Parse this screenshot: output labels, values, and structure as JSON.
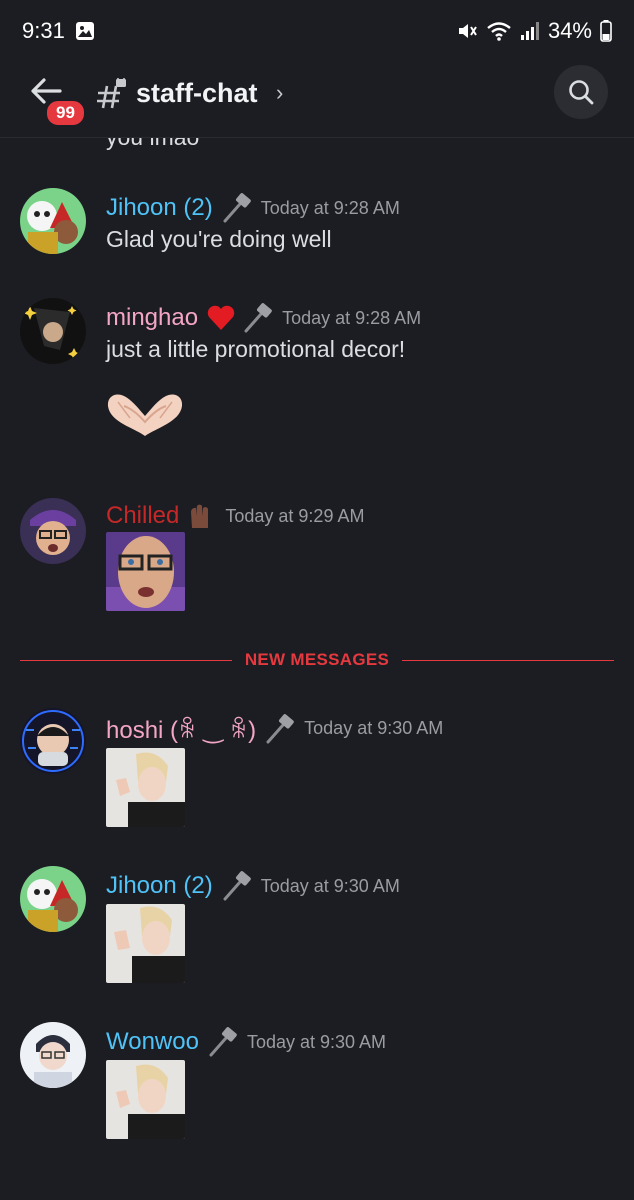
{
  "status_bar": {
    "time": "9:31",
    "battery": "34%"
  },
  "header": {
    "unread_badge": "99",
    "channel_name": "staff-chat"
  },
  "cut_off_text": "you lmao",
  "messages": [
    {
      "username": "Jihoon (2)",
      "name_color": "#4fc3f7",
      "timestamp": "Today at 9:28 AM",
      "text": "Glad you're doing well"
    },
    {
      "username": "minghao",
      "name_color": "#f4a6c6",
      "timestamp": "Today at 9:28 AM",
      "text": "just a little promotional decor!"
    },
    {
      "username": "Chilled",
      "name_color": "#c62828",
      "timestamp": "Today at 9:29 AM",
      "text": ""
    },
    {
      "username": "hoshi (ꆜ ‿ ꆜ)",
      "name_color": "#f4a6c6",
      "timestamp": "Today at 9:30 AM",
      "text": ""
    },
    {
      "username": "Jihoon (2)",
      "name_color": "#4fc3f7",
      "timestamp": "Today at 9:30 AM",
      "text": ""
    },
    {
      "username": "Wonwoo",
      "name_color": "#4fc3f7",
      "timestamp": "Today at 9:30 AM",
      "text": ""
    }
  ],
  "divider_label": "NEW MESSAGES",
  "colors": {
    "background": "#1c1d22",
    "accent_red": "#e5393f",
    "timestamp": "#9a9ca3"
  }
}
